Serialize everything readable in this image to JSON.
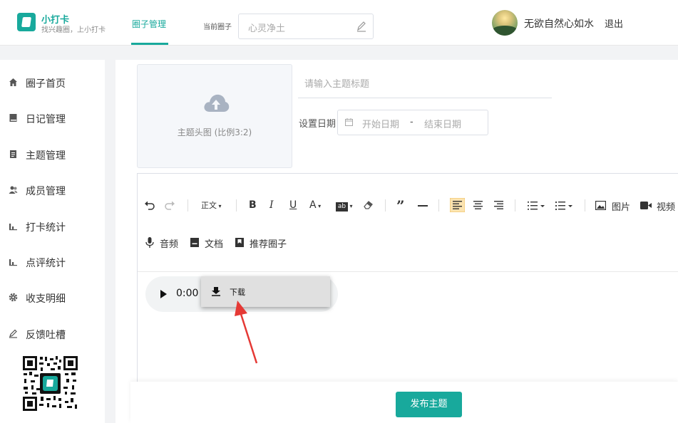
{
  "header": {
    "brand_name": "小打卡",
    "brand_slogan": "找兴趣圈，上小打卡",
    "nav_tab": "圈子管理",
    "current_circle_label": "当前圈子",
    "current_circle_value": "心灵净土",
    "user_name": "无欲自然心如水",
    "logout": "退出"
  },
  "sidebar": {
    "items": [
      {
        "label": "圈子首页",
        "icon": "home-icon"
      },
      {
        "label": "日记管理",
        "icon": "book-icon"
      },
      {
        "label": "主题管理",
        "icon": "document-icon"
      },
      {
        "label": "成员管理",
        "icon": "members-icon"
      },
      {
        "label": "打卡统计",
        "icon": "bar-chart-icon"
      },
      {
        "label": "点评统计",
        "icon": "bar-chart-icon"
      },
      {
        "label": "收支明细",
        "icon": "gear-icon"
      },
      {
        "label": "反馈吐槽",
        "icon": "pencil-icon"
      }
    ]
  },
  "form": {
    "cover_text": "主题头图 (比例3:2)",
    "title_placeholder": "请输入主题标题",
    "date_label": "设置日期",
    "start_placeholder": "开始日期",
    "range_separator": "-",
    "end_placeholder": "结束日期"
  },
  "toolbar": {
    "heading": "正文",
    "image": "图片",
    "video": "视频",
    "audio": "音频",
    "file": "文档",
    "recommend": "推荐圈子"
  },
  "audio_player": {
    "time": "0:00 /"
  },
  "context_menu": {
    "download": "下载"
  },
  "footer": {
    "publish": "发布主题"
  },
  "colors": {
    "accent": "#18a99c",
    "annotation_arrow": "#e53935"
  }
}
